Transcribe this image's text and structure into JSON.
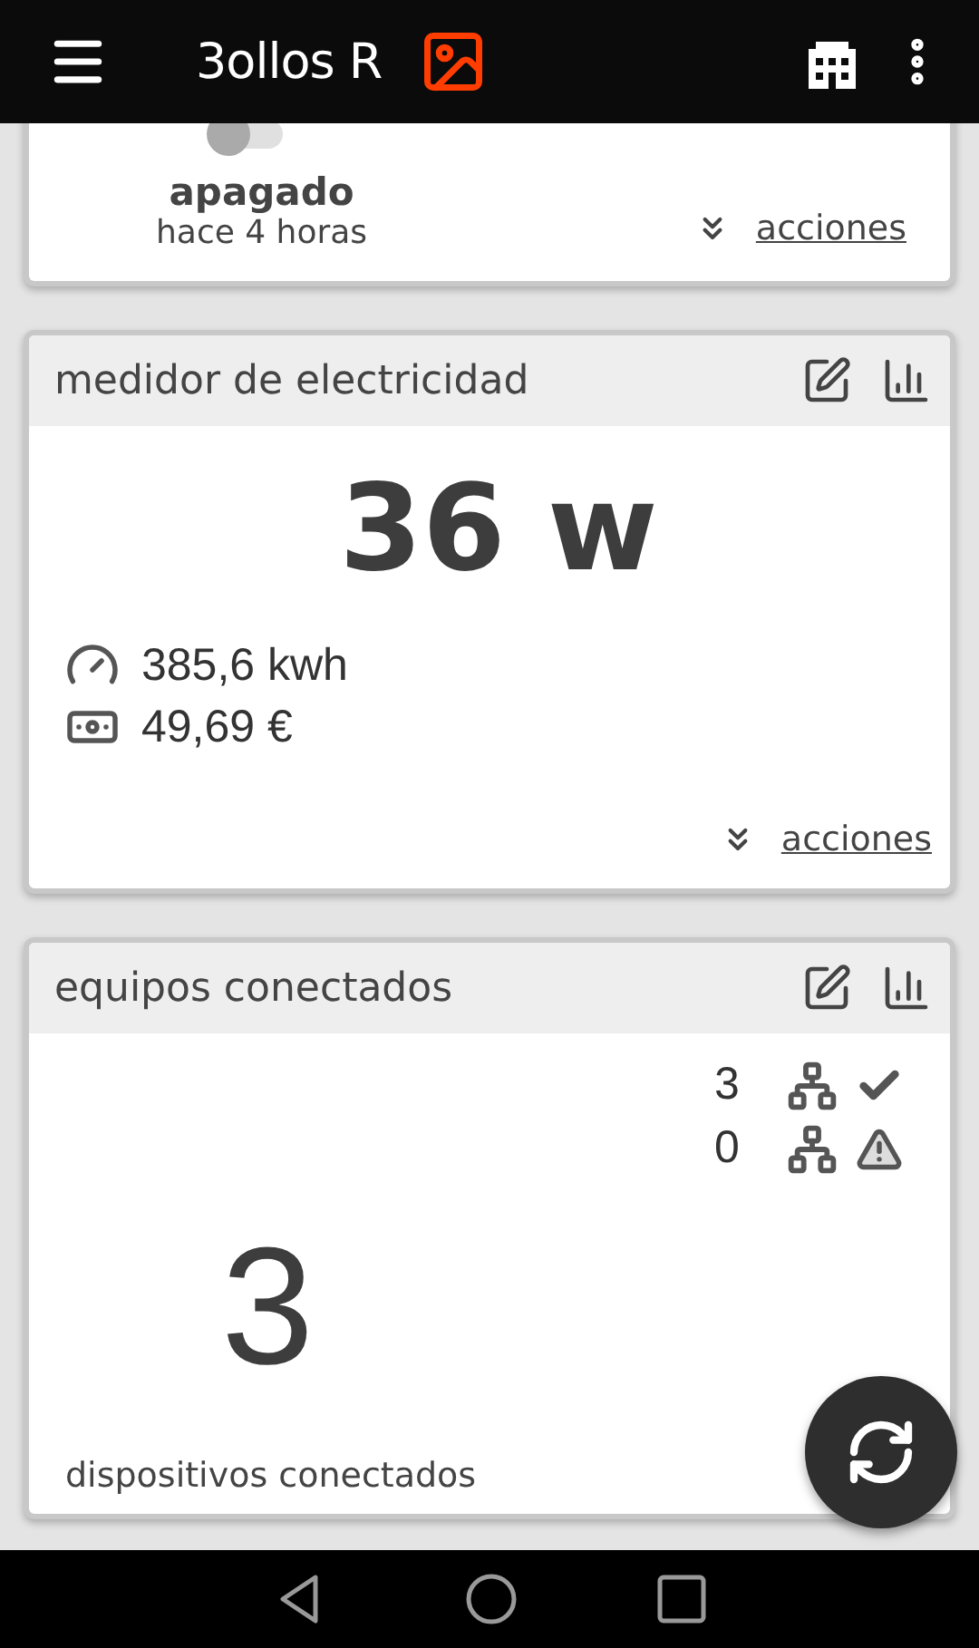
{
  "app_bar": {
    "title": "3ollos R"
  },
  "cards": [
    {
      "kind": "switch",
      "on": false,
      "state": "apagado",
      "time": "hace 4 horas",
      "action": "acciones"
    },
    {
      "kind": "meter",
      "title": "medidor de electricidad",
      "value": "36 w",
      "readings": [
        {
          "kind": "energy",
          "text": "385,6 kwh"
        },
        {
          "kind": "cost",
          "text": "49,69 €"
        }
      ],
      "action": "acciones"
    },
    {
      "kind": "devices",
      "title": "equipos conectados",
      "count": "3",
      "stats": [
        {
          "kind": "ok",
          "count": "3"
        },
        {
          "kind": "warning",
          "count": "0"
        }
      ],
      "label": "dispositivos conectados"
    }
  ]
}
